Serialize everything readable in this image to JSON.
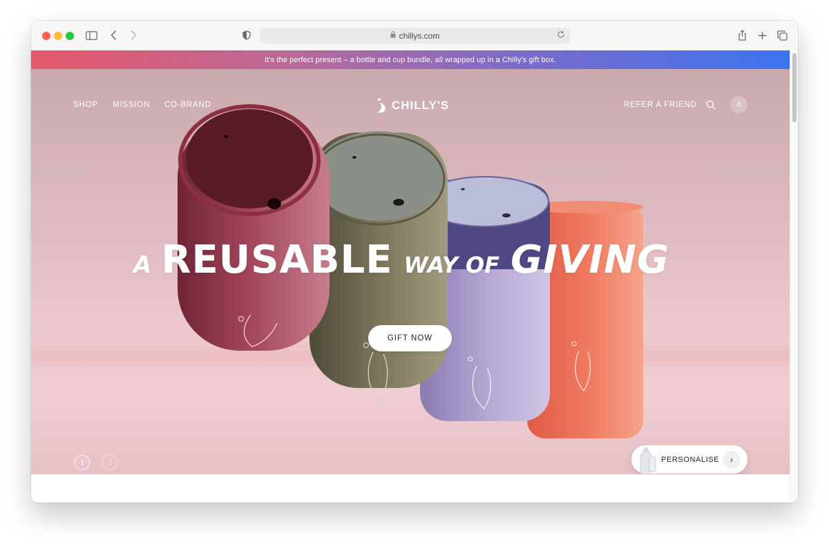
{
  "browser": {
    "url": "chillys.com"
  },
  "promo": {
    "text": "It's the perfect present – a bottle and cup bundle, all wrapped up in a Chilly's gift box."
  },
  "nav": {
    "left": [
      "SHOP",
      "MISSION",
      "CO-BRAND"
    ],
    "brand": "CHILLY'S",
    "refer": "REFER A FRIEND",
    "cart_count": "0"
  },
  "hero": {
    "headline": [
      "A",
      "REUSABLE",
      "WAY OF",
      "GIVING"
    ],
    "cta": "GIFT NOW",
    "slides": [
      "1",
      "2"
    ],
    "personalise": "PERSONALISE",
    "personalise_arrow": "›"
  },
  "colors": {
    "cup_burgundy": "#8d3a4c",
    "cup_olive": "#6e6a52",
    "cup_lavender": "#a79ac4",
    "cup_coral": "#e86a54",
    "promo_left": "#e6586a",
    "promo_right": "#3c74f0"
  },
  "icons": [
    "sidebar-icon",
    "back-icon",
    "forward-icon",
    "shield-icon",
    "lock-icon",
    "reload-icon",
    "share-icon",
    "new-tab-icon",
    "tabs-icon",
    "search-icon",
    "bottle-icon"
  ]
}
